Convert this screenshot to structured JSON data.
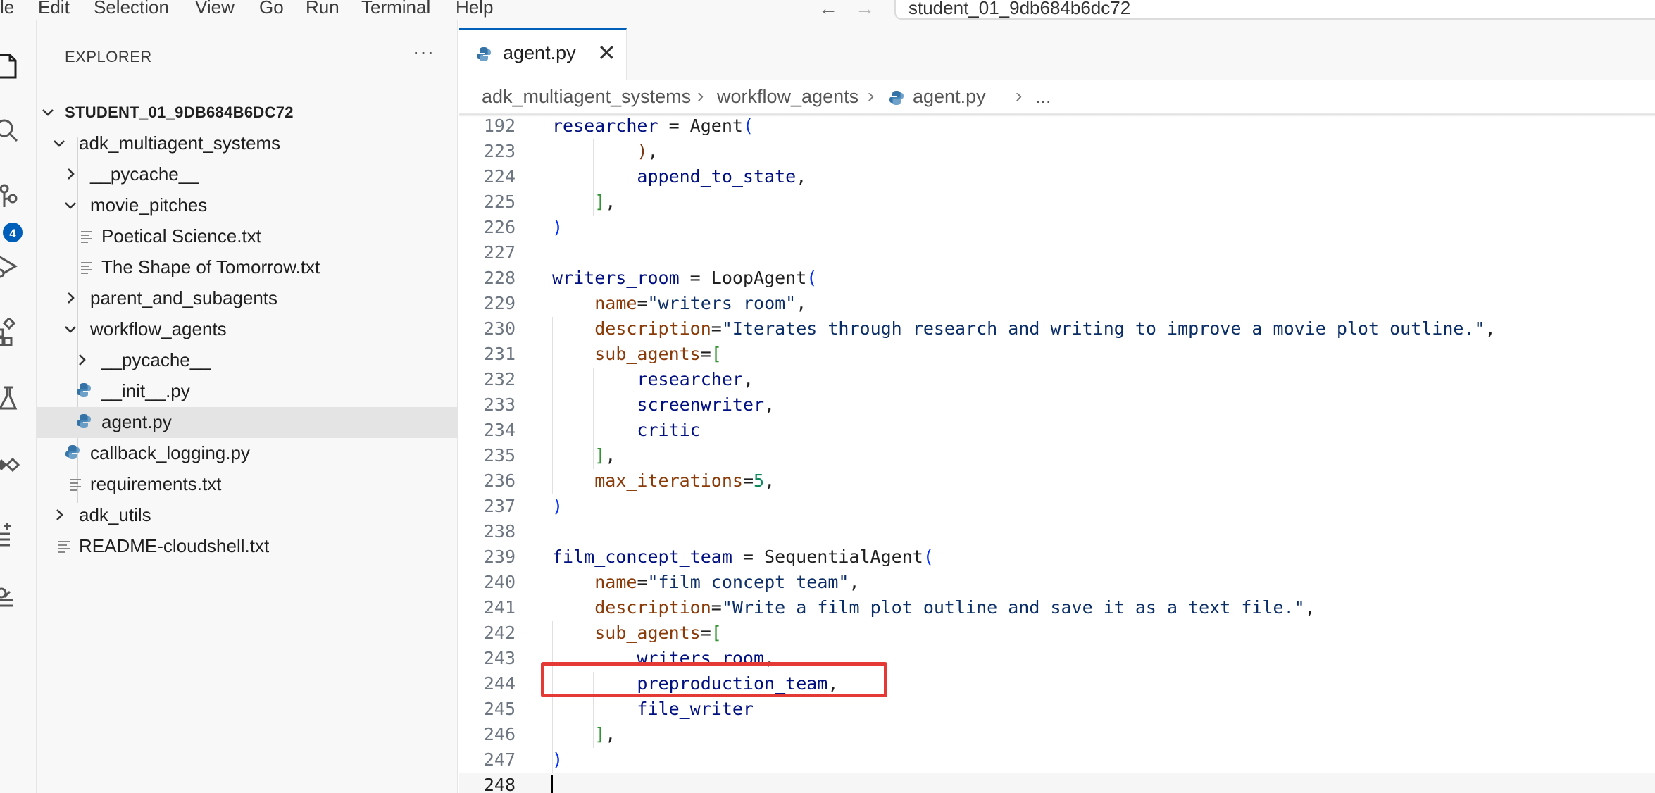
{
  "menubar": {
    "items": [
      "le",
      "Edit",
      "Selection",
      "View",
      "Go",
      "Run",
      "Terminal",
      "Help"
    ],
    "command_center": "student_01_9db684b6dc72"
  },
  "activitybar": {
    "icons": [
      "explorer-icon",
      "search-icon",
      "source-control-icon",
      "run-debug-icon",
      "extensions-icon",
      "testing-icon",
      "remote-icon",
      "checklist-icon",
      "cloud-code-icon"
    ],
    "scm_badge": "4"
  },
  "sidebar": {
    "title": "EXPLORER",
    "more": "···",
    "tree": [
      {
        "label": "STUDENT_01_9DB684B6DC72",
        "type": "root"
      },
      {
        "label": "adk_multiagent_systems",
        "type": "folder-open"
      },
      {
        "label": "__pycache__",
        "type": "folder-closed"
      },
      {
        "label": "movie_pitches",
        "type": "folder-open"
      },
      {
        "label": "Poetical Science.txt",
        "type": "text"
      },
      {
        "label": "The Shape of Tomorrow.txt",
        "type": "text"
      },
      {
        "label": "parent_and_subagents",
        "type": "folder-closed"
      },
      {
        "label": "workflow_agents",
        "type": "folder-open"
      },
      {
        "label": "__pycache__",
        "type": "folder-closed"
      },
      {
        "label": "__init__.py",
        "type": "python"
      },
      {
        "label": "agent.py",
        "type": "python",
        "selected": true
      },
      {
        "label": "callback_logging.py",
        "type": "python"
      },
      {
        "label": "requirements.txt",
        "type": "text"
      },
      {
        "label": "adk_utils",
        "type": "folder-closed"
      },
      {
        "label": "README-cloudshell.txt",
        "type": "text"
      }
    ]
  },
  "tab": {
    "label": "agent.py",
    "close": "✕"
  },
  "breadcrumb": [
    "adk_multiagent_systems",
    "workflow_agents",
    "agent.py",
    "..."
  ],
  "editor": {
    "lines": [
      {
        "n": "192",
        "tokens": [
          [
            "t-var",
            "researcher"
          ],
          [
            "",
            " = "
          ],
          [
            "",
            "Agent"
          ],
          [
            "t-p1",
            "("
          ]
        ]
      },
      {
        "n": "223",
        "tokens": [
          [
            "",
            "        "
          ],
          [
            "t-p3",
            ")"
          ],
          [
            "",
            ","
          ]
        ]
      },
      {
        "n": "224",
        "tokens": [
          [
            "",
            "        "
          ],
          [
            "t-var",
            "append_to_state"
          ],
          [
            "",
            ","
          ]
        ]
      },
      {
        "n": "225",
        "tokens": [
          [
            "",
            "    "
          ],
          [
            "t-p2",
            "]"
          ],
          [
            "",
            ","
          ]
        ]
      },
      {
        "n": "226",
        "tokens": [
          [
            "t-p1",
            ")"
          ]
        ]
      },
      {
        "n": "227",
        "tokens": []
      },
      {
        "n": "228",
        "tokens": [
          [
            "t-var",
            "writers_room"
          ],
          [
            "",
            " = "
          ],
          [
            "",
            "LoopAgent"
          ],
          [
            "t-p1",
            "("
          ]
        ]
      },
      {
        "n": "229",
        "tokens": [
          [
            "",
            "    "
          ],
          [
            "t-param",
            "name"
          ],
          [
            "",
            "="
          ],
          [
            "t-str",
            "\"writers_room\""
          ],
          [
            "",
            ","
          ]
        ]
      },
      {
        "n": "230",
        "tokens": [
          [
            "",
            "    "
          ],
          [
            "t-param",
            "description"
          ],
          [
            "",
            "="
          ],
          [
            "t-str",
            "\"Iterates through research and writing to improve a movie plot outline.\""
          ],
          [
            "",
            ","
          ]
        ]
      },
      {
        "n": "231",
        "tokens": [
          [
            "",
            "    "
          ],
          [
            "t-param",
            "sub_agents"
          ],
          [
            "",
            "="
          ],
          [
            "t-p2",
            "["
          ]
        ]
      },
      {
        "n": "232",
        "tokens": [
          [
            "",
            "        "
          ],
          [
            "t-var",
            "researcher"
          ],
          [
            "",
            ","
          ]
        ]
      },
      {
        "n": "233",
        "tokens": [
          [
            "",
            "        "
          ],
          [
            "t-var",
            "screenwriter"
          ],
          [
            "",
            ","
          ]
        ]
      },
      {
        "n": "234",
        "tokens": [
          [
            "",
            "        "
          ],
          [
            "t-var",
            "critic"
          ]
        ]
      },
      {
        "n": "235",
        "tokens": [
          [
            "",
            "    "
          ],
          [
            "t-p2",
            "]"
          ],
          [
            "",
            ","
          ]
        ]
      },
      {
        "n": "236",
        "tokens": [
          [
            "",
            "    "
          ],
          [
            "t-param",
            "max_iterations"
          ],
          [
            "",
            "="
          ],
          [
            "t-num",
            "5"
          ],
          [
            "",
            ","
          ]
        ]
      },
      {
        "n": "237",
        "tokens": [
          [
            "t-p1",
            ")"
          ]
        ]
      },
      {
        "n": "238",
        "tokens": []
      },
      {
        "n": "239",
        "tokens": [
          [
            "t-var",
            "film_concept_team"
          ],
          [
            "",
            " = "
          ],
          [
            "",
            "SequentialAgent"
          ],
          [
            "t-p1",
            "("
          ]
        ]
      },
      {
        "n": "240",
        "tokens": [
          [
            "",
            "    "
          ],
          [
            "t-param",
            "name"
          ],
          [
            "",
            "="
          ],
          [
            "t-str",
            "\"film_concept_team\""
          ],
          [
            "",
            ","
          ]
        ]
      },
      {
        "n": "241",
        "tokens": [
          [
            "",
            "    "
          ],
          [
            "t-param",
            "description"
          ],
          [
            "",
            "="
          ],
          [
            "t-str",
            "\"Write a film plot outline and save it as a text file.\""
          ],
          [
            "",
            ","
          ]
        ]
      },
      {
        "n": "242",
        "tokens": [
          [
            "",
            "    "
          ],
          [
            "t-param",
            "sub_agents"
          ],
          [
            "",
            "="
          ],
          [
            "t-p2",
            "["
          ]
        ]
      },
      {
        "n": "243",
        "tokens": [
          [
            "",
            "        "
          ],
          [
            "t-var",
            "writers_room"
          ],
          [
            "",
            ","
          ]
        ]
      },
      {
        "n": "244",
        "tokens": [
          [
            "",
            "        "
          ],
          [
            "t-var",
            "preproduction_team"
          ],
          [
            "",
            ","
          ]
        ]
      },
      {
        "n": "245",
        "tokens": [
          [
            "",
            "        "
          ],
          [
            "t-var",
            "file_writer"
          ]
        ]
      },
      {
        "n": "246",
        "tokens": [
          [
            "",
            "    "
          ],
          [
            "t-p2",
            "]"
          ],
          [
            "",
            ","
          ]
        ]
      },
      {
        "n": "247",
        "tokens": [
          [
            "t-p1",
            ")"
          ]
        ]
      },
      {
        "n": "248",
        "tokens": [],
        "current": true
      }
    ]
  },
  "colors": {
    "accent": "#005fb8",
    "highlight_box": "#e53935",
    "string": "#0b2e67",
    "param": "#8a3b0a",
    "number": "#098658"
  }
}
